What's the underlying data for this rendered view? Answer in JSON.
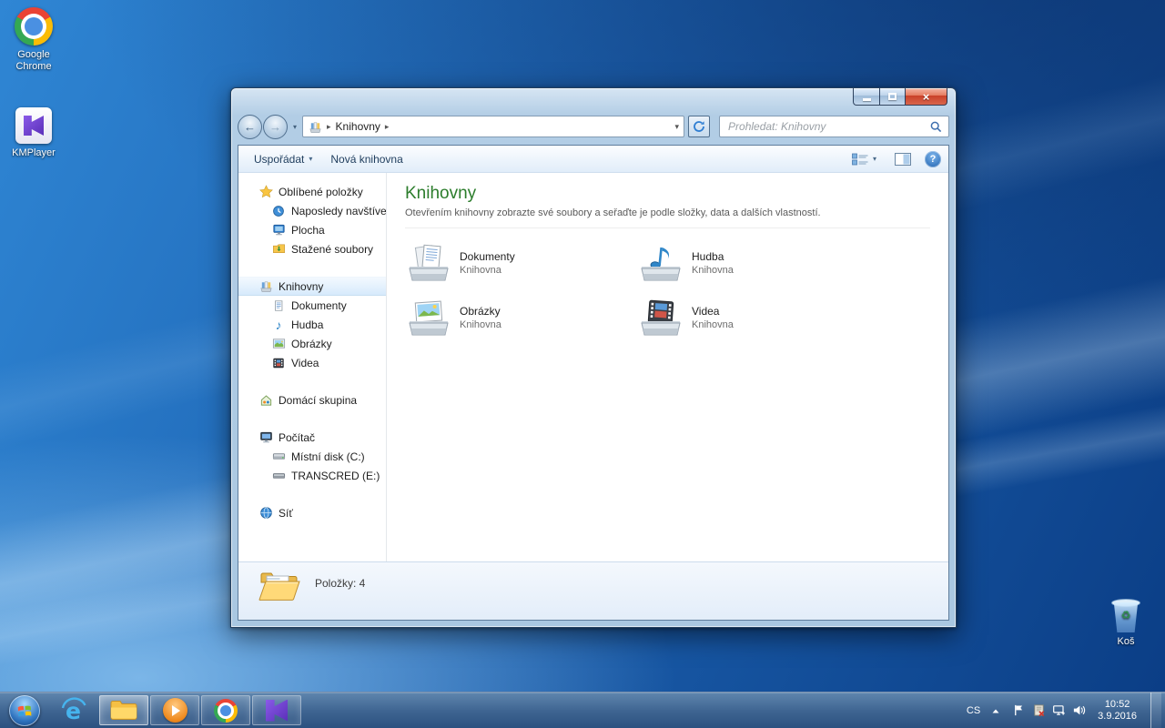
{
  "desktop": {
    "chrome_label": "Google Chrome",
    "kmplayer_label": "KMPlayer",
    "recycle_label": "Koš"
  },
  "window": {
    "nav": {
      "breadcrumb_root": "Knihovny",
      "search_placeholder": "Prohledat: Knihovny"
    },
    "toolbar": {
      "organize": "Uspořádat",
      "new_library": "Nová knihovna"
    },
    "sidebar": {
      "favorites": {
        "label": "Oblíbené položky",
        "items": [
          "Naposledy navštívené",
          "Plocha",
          "Stažené soubory"
        ]
      },
      "libraries": {
        "label": "Knihovny",
        "items": [
          "Dokumenty",
          "Hudba",
          "Obrázky",
          "Videa"
        ]
      },
      "homegroup": {
        "label": "Domácí skupina"
      },
      "computer": {
        "label": "Počítač",
        "items": [
          "Místní disk (C:)",
          "TRANSCRED (E:)"
        ]
      },
      "network": {
        "label": "Síť"
      }
    },
    "main": {
      "title": "Knihovny",
      "subtitle": "Otevřením knihovny zobrazte své soubory a seřaďte je podle složky, data a dalších vlastností.",
      "items": [
        {
          "name": "Dokumenty",
          "type": "Knihovna"
        },
        {
          "name": "Hudba",
          "type": "Knihovna"
        },
        {
          "name": "Obrázky",
          "type": "Knihovna"
        },
        {
          "name": "Videa",
          "type": "Knihovna"
        }
      ]
    },
    "statusbar": {
      "count_text": "Položky: 4"
    }
  },
  "taskbar": {
    "tray": {
      "language": "CS",
      "time": "10:52",
      "date": "3.9.2016"
    }
  },
  "colors": {
    "header_green": "#2c7d2c",
    "selection_blue": "#d7eafc",
    "close_red": "#c94028",
    "taskbar_blue": "#3d6390"
  }
}
